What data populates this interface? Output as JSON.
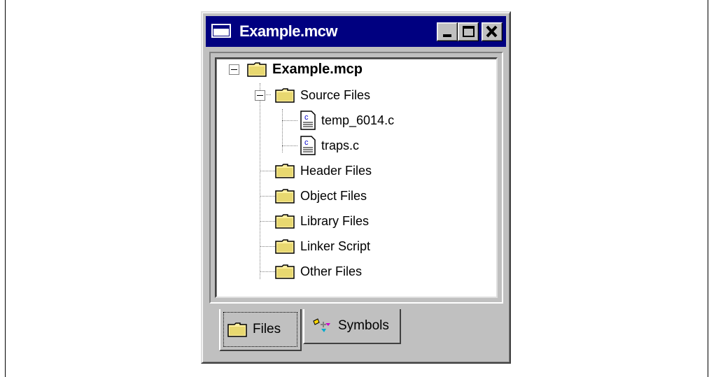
{
  "window": {
    "title": "Example.mcw",
    "icon": "app-window-icon",
    "controls": {
      "minimize": "minimize-icon",
      "maximize": "maximize-icon",
      "close": "close-icon"
    }
  },
  "tree": {
    "root": {
      "label": "Example.mcp",
      "icon": "folder-icon",
      "expanded": true
    },
    "source_files": {
      "label": "Source Files",
      "icon": "folder-icon",
      "expanded": true,
      "children": [
        {
          "label": "temp_6014.c",
          "icon": "c-file-icon"
        },
        {
          "label": "traps.c",
          "icon": "c-file-icon"
        }
      ]
    },
    "other_folders": [
      {
        "label": "Header Files",
        "icon": "folder-icon"
      },
      {
        "label": "Object Files",
        "icon": "folder-icon"
      },
      {
        "label": "Library Files",
        "icon": "folder-icon"
      },
      {
        "label": "Linker Script",
        "icon": "folder-icon"
      },
      {
        "label": "Other Files",
        "icon": "folder-icon"
      }
    ]
  },
  "tabs": [
    {
      "label": "Files",
      "icon": "folder-icon",
      "selected": true
    },
    {
      "label": "Symbols",
      "icon": "symbols-icon",
      "selected": false
    }
  ],
  "colors": {
    "titlebar": "#000080",
    "folder": "#fff0a0",
    "face": "#c0c0c0"
  }
}
